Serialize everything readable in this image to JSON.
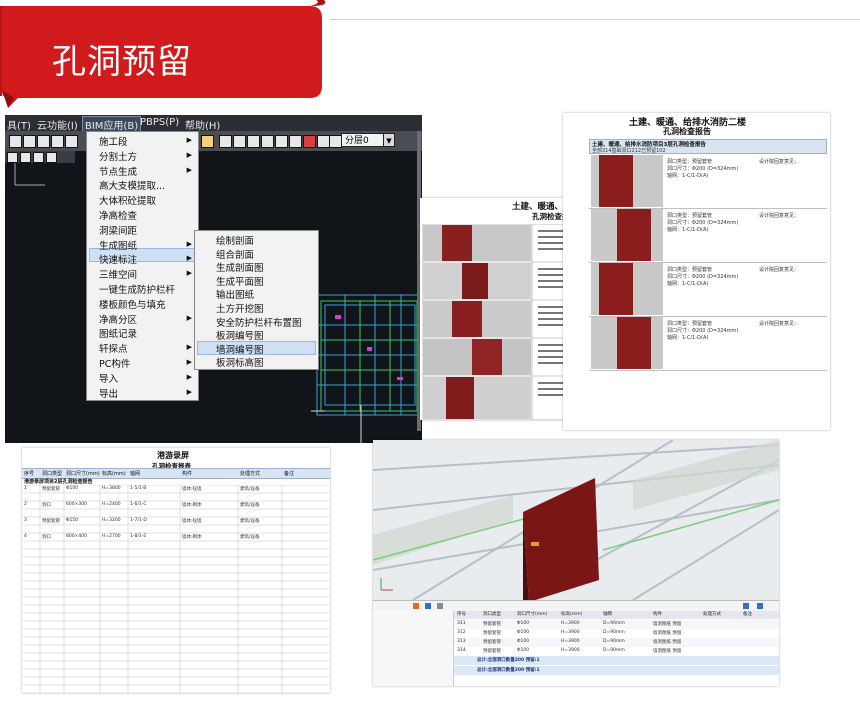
{
  "banner": {
    "title": "孔洞预留",
    "color": "#d11a1c"
  },
  "cad": {
    "menubar": [
      "具(T)",
      "云功能(I)",
      "BIM应用(B)",
      "PBPS(P)",
      "帮助(H)"
    ],
    "active_menu": "BIM应用(B)",
    "layer_select": "分层0",
    "bim_menu": [
      {
        "label": "施工段",
        "sub": true
      },
      {
        "label": "分割土方",
        "sub": true
      },
      {
        "label": "节点生成",
        "sub": true
      },
      {
        "label": "高大支模提取...",
        "sub": false
      },
      {
        "label": "大体积砼提取",
        "sub": false
      },
      {
        "label": "净高检查",
        "sub": false
      },
      {
        "label": "洞梁间距",
        "sub": false
      },
      {
        "label": "生成图纸",
        "sub": true
      },
      {
        "label": "快速标注",
        "sub": true
      },
      {
        "label": "三维空间",
        "sub": true
      },
      {
        "label": "一键生成防护栏杆",
        "sub": false
      },
      {
        "label": "楼板颜色与填充",
        "sub": false
      },
      {
        "label": "净高分区",
        "sub": true
      },
      {
        "label": "图纸记录",
        "sub": false
      },
      {
        "label": "轩探点",
        "sub": true
      },
      {
        "label": "PC构件",
        "sub": true
      },
      {
        "label": "导入",
        "sub": true
      },
      {
        "label": "导出",
        "sub": true
      }
    ],
    "drawing_submenu": [
      "绘制剖面",
      "组合剖面",
      "生成剖面图",
      "生成平面图",
      "输出图纸",
      "土方开挖图",
      "安全防护栏杆布置图",
      "板洞编号图",
      "墙洞编号图",
      "板洞标高图"
    ],
    "highlighted_submenu": "墙洞编号图"
  },
  "report1": {
    "title_line1": "土建、暖通、给排水消防二",
    "title_line2": "孔洞检查报告",
    "rows": 5
  },
  "report2": {
    "title_line1": "土建、暖通、给排水消防二楼",
    "title_line2": "孔洞检查报告",
    "section": "土建、暖通、给排水消防项目3层孔洞检查报告",
    "section_sub": "全部314基础洞口212已预留102",
    "entries": [
      {
        "l1": "洞口类型：预留套管",
        "l2": "洞口尺寸：Φ200 (D=324mm)",
        "l3": "轴网：1-C/1-D(A)",
        "comment": "设计院回复意见："
      },
      {
        "l1": "洞口类型：预留套管",
        "l2": "洞口尺寸：Φ200 (D=324mm)",
        "l3": "轴网：1-C/1-D(A)",
        "comment": "设计院回复意见："
      },
      {
        "l1": "洞口类型：预留套管",
        "l2": "洞口尺寸：Φ200 (D=324mm)",
        "l3": "轴网：1-C/1-D(A)",
        "comment": "设计院回复意见："
      },
      {
        "l1": "洞口类型：预留套管",
        "l2": "洞口尺寸：Φ200 (D=324mm)",
        "l3": "轴网：1-C/1-D(A)",
        "comment": "设计院回复意见："
      }
    ]
  },
  "report3": {
    "title": "港游录屏",
    "subtitle": "孔洞检查报表",
    "headers": [
      "序号",
      "洞口类型",
      "洞口尺寸(mm)",
      "标高(mm)",
      "轴网",
      "构件",
      "处理方式",
      "备注"
    ],
    "section1": "港游录屏项目2层孔洞检查报告",
    "rows": [
      [
        "1",
        "预留套管",
        "Φ100",
        "H=3800",
        "1-5/1-B",
        "墙体:砼墙",
        "建筑/设备"
      ],
      [
        "2",
        "洞口",
        "600×300",
        "H=2400",
        "1-6/1-C",
        "墙体:砌体",
        "建筑/设备"
      ],
      [
        "3",
        "预留套管",
        "Φ150",
        "H=3200",
        "1-7/1-D",
        "墙体:砼墙",
        "建筑/设备"
      ],
      [
        "4",
        "洞口",
        "800×400",
        "H=2700",
        "1-8/1-E",
        "墙体:砌体",
        "建筑/设备"
      ]
    ]
  },
  "view3d": {
    "table_headers": [
      "序号",
      "洞口类型",
      "洞口尺寸(mm)",
      "标高(mm)",
      "轴网",
      "构件",
      "处理方式",
      "备注"
    ],
    "rows": [
      [
        "311",
        "预留套管",
        "Φ100",
        "H=3900",
        "D=90mm",
        "墙洞图纸 预留"
      ],
      [
        "312",
        "预留套管",
        "Φ100",
        "H=3900",
        "D=90mm",
        "墙洞图纸 预留"
      ],
      [
        "313",
        "预留套管",
        "Φ100",
        "H=3900",
        "D=90mm",
        "墙洞图纸 预留"
      ],
      [
        "314",
        "预留套管",
        "Φ100",
        "H=3900",
        "D=90mm",
        "墙洞图纸 预留"
      ]
    ],
    "group_rows": [
      "总计:全部洞口数量200 预留:1",
      "总计:全部洞口数量200 预留:1"
    ]
  }
}
